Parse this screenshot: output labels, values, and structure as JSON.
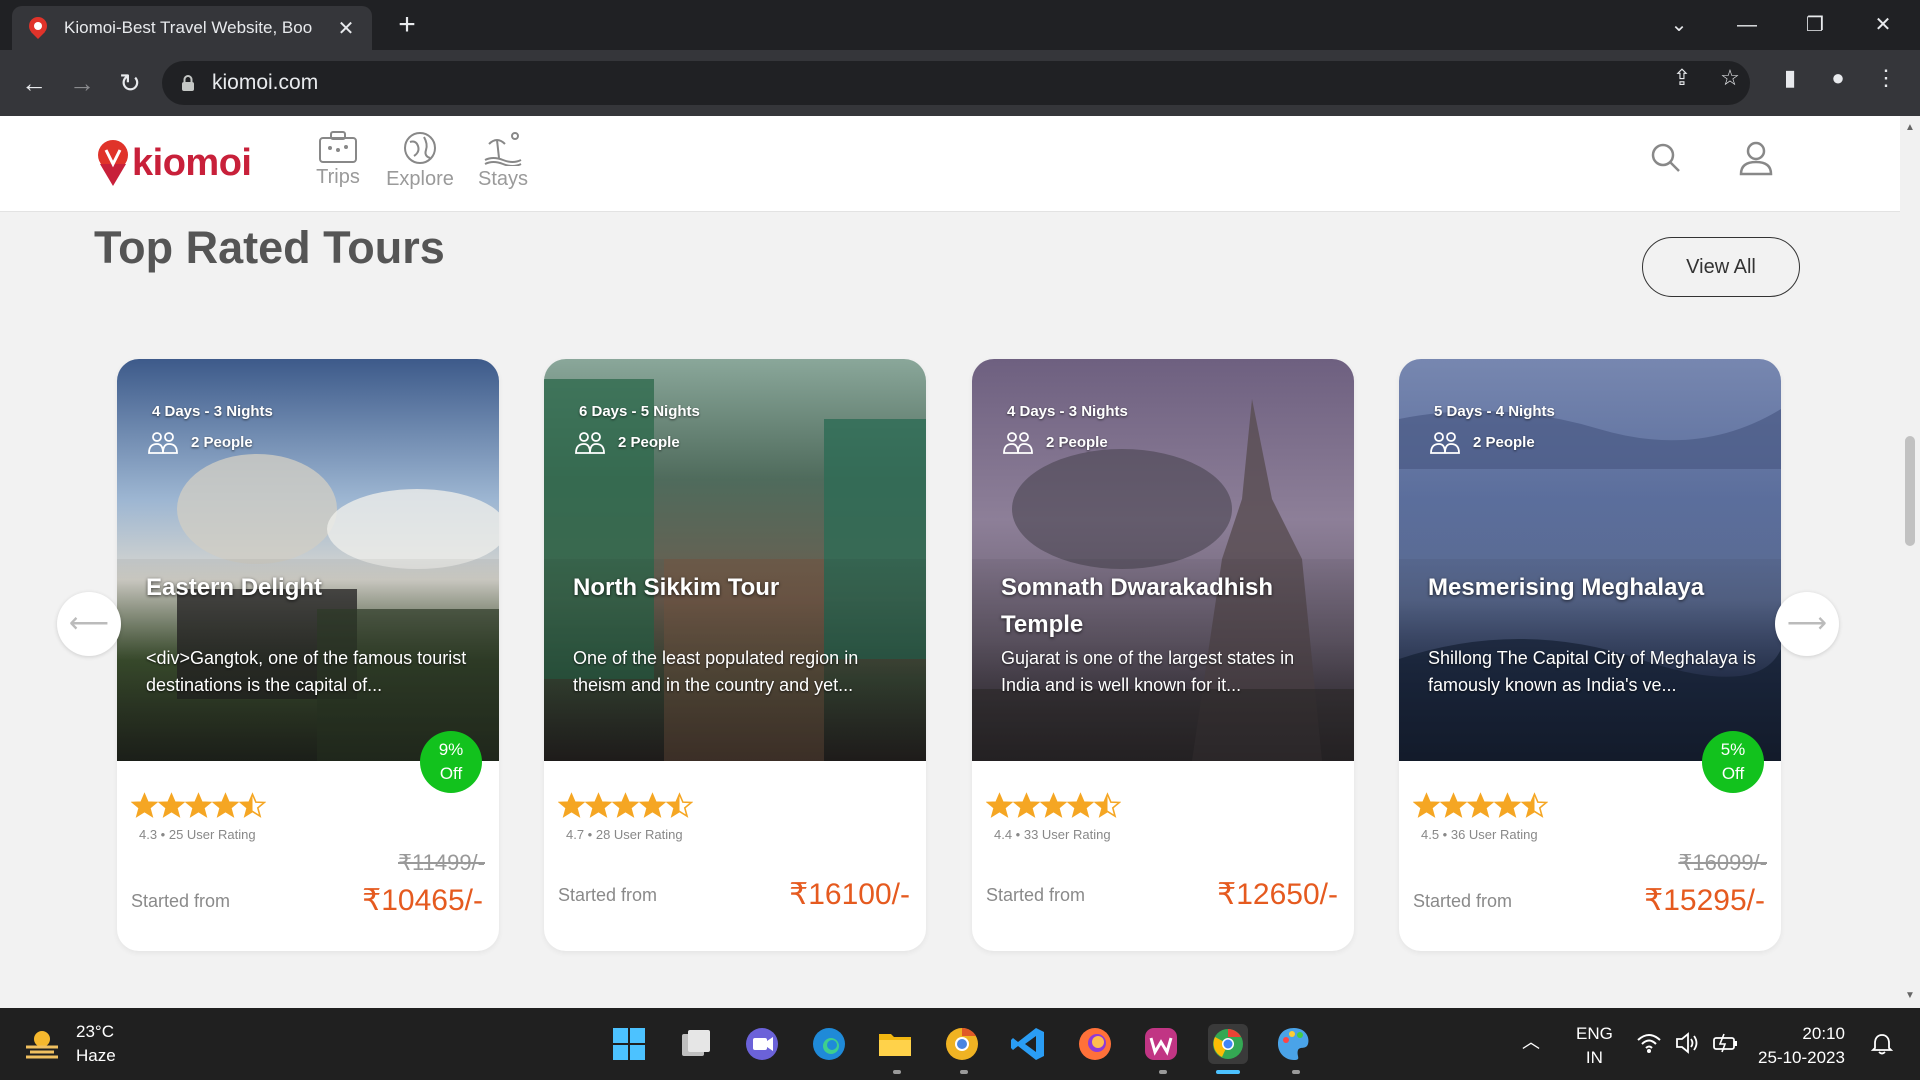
{
  "browser": {
    "tab_title": "Kiomoi-Best Travel Website, Boo",
    "url": "kiomoi.com"
  },
  "header": {
    "brand": "kiomoi",
    "nav": [
      {
        "label": "Trips",
        "icon": "suitcase-icon"
      },
      {
        "label": "Explore",
        "icon": "globe-icon"
      },
      {
        "label": "Stays",
        "icon": "beach-icon"
      }
    ]
  },
  "section": {
    "title": "Top Rated Tours",
    "view_all": "View All"
  },
  "tours": [
    {
      "duration": "4 Days - 3 Nights",
      "people": "2 People",
      "title": "Eastern Delight",
      "desc": "<div>Gangtok, one of the famous tourist destinations is the capital of...",
      "discount_pct": "9%",
      "discount_off": "Off",
      "rating_text": "4.3 • 25 User Rating",
      "old_price": "₹11499/-",
      "started": "Started from",
      "price": "₹10465/-",
      "image_colors": [
        "#3d5a8a",
        "#9db6d2",
        "#e8e6df",
        "#445a35",
        "#2a2f26"
      ]
    },
    {
      "duration": "6 Days - 5 Nights",
      "people": "2 People",
      "title": "North Sikkim Tour",
      "desc": "One of the least populated region in theism and in the country and yet...",
      "discount_pct": "",
      "discount_off": "",
      "rating_text": "4.7 • 28 User Rating",
      "old_price": "",
      "started": "Started from",
      "price": "₹16100/-",
      "image_colors": [
        "#4f6b5c",
        "#7e9f8d",
        "#6d5e50",
        "#3d4c3a",
        "#2e2a28"
      ]
    },
    {
      "duration": "4 Days - 3 Nights",
      "people": "2 People",
      "title": "Somnath Dwarakadhish Temple",
      "desc": "Gujarat is one of the largest states in India and is well known for it...",
      "discount_pct": "",
      "discount_off": "",
      "rating_text": "4.4 • 33 User Rating",
      "old_price": "",
      "started": "Started from",
      "price": "₹12650/-",
      "image_colors": [
        "#6e6080",
        "#8d7f98",
        "#6a6070",
        "#4b4550",
        "#2f2a30"
      ]
    },
    {
      "duration": "5 Days - 4 Nights",
      "people": "2 People",
      "title": "Mesmerising Meghalaya",
      "desc": "Shillong The Capital City of Meghalaya is famously known as India's ve...",
      "discount_pct": "5%",
      "discount_off": "Off",
      "rating_text": "4.5 • 36 User Rating",
      "old_price": "₹16099/-",
      "started": "Started from",
      "price": "₹15295/-",
      "image_colors": [
        "#5b6e9c",
        "#7787b0",
        "#5a6a90",
        "#2d3b5c",
        "#1e2538"
      ]
    }
  ],
  "taskbar": {
    "temp": "23°C",
    "weather": "Haze",
    "lang1": "ENG",
    "lang2": "IN",
    "time": "20:10",
    "date": "25-10-2023",
    "apps": [
      "windows-start-icon",
      "task-view-icon",
      "chat-icon",
      "edge-icon",
      "file-explorer-icon",
      "chrome-canary-icon",
      "vscode-icon",
      "firefox-icon",
      "wps-icon",
      "chrome-icon",
      "paint-icon"
    ]
  },
  "colors": {
    "accent": "#c8203a",
    "price": "#e55a1f",
    "discount": "#12c21d",
    "star": "#f5a623"
  }
}
